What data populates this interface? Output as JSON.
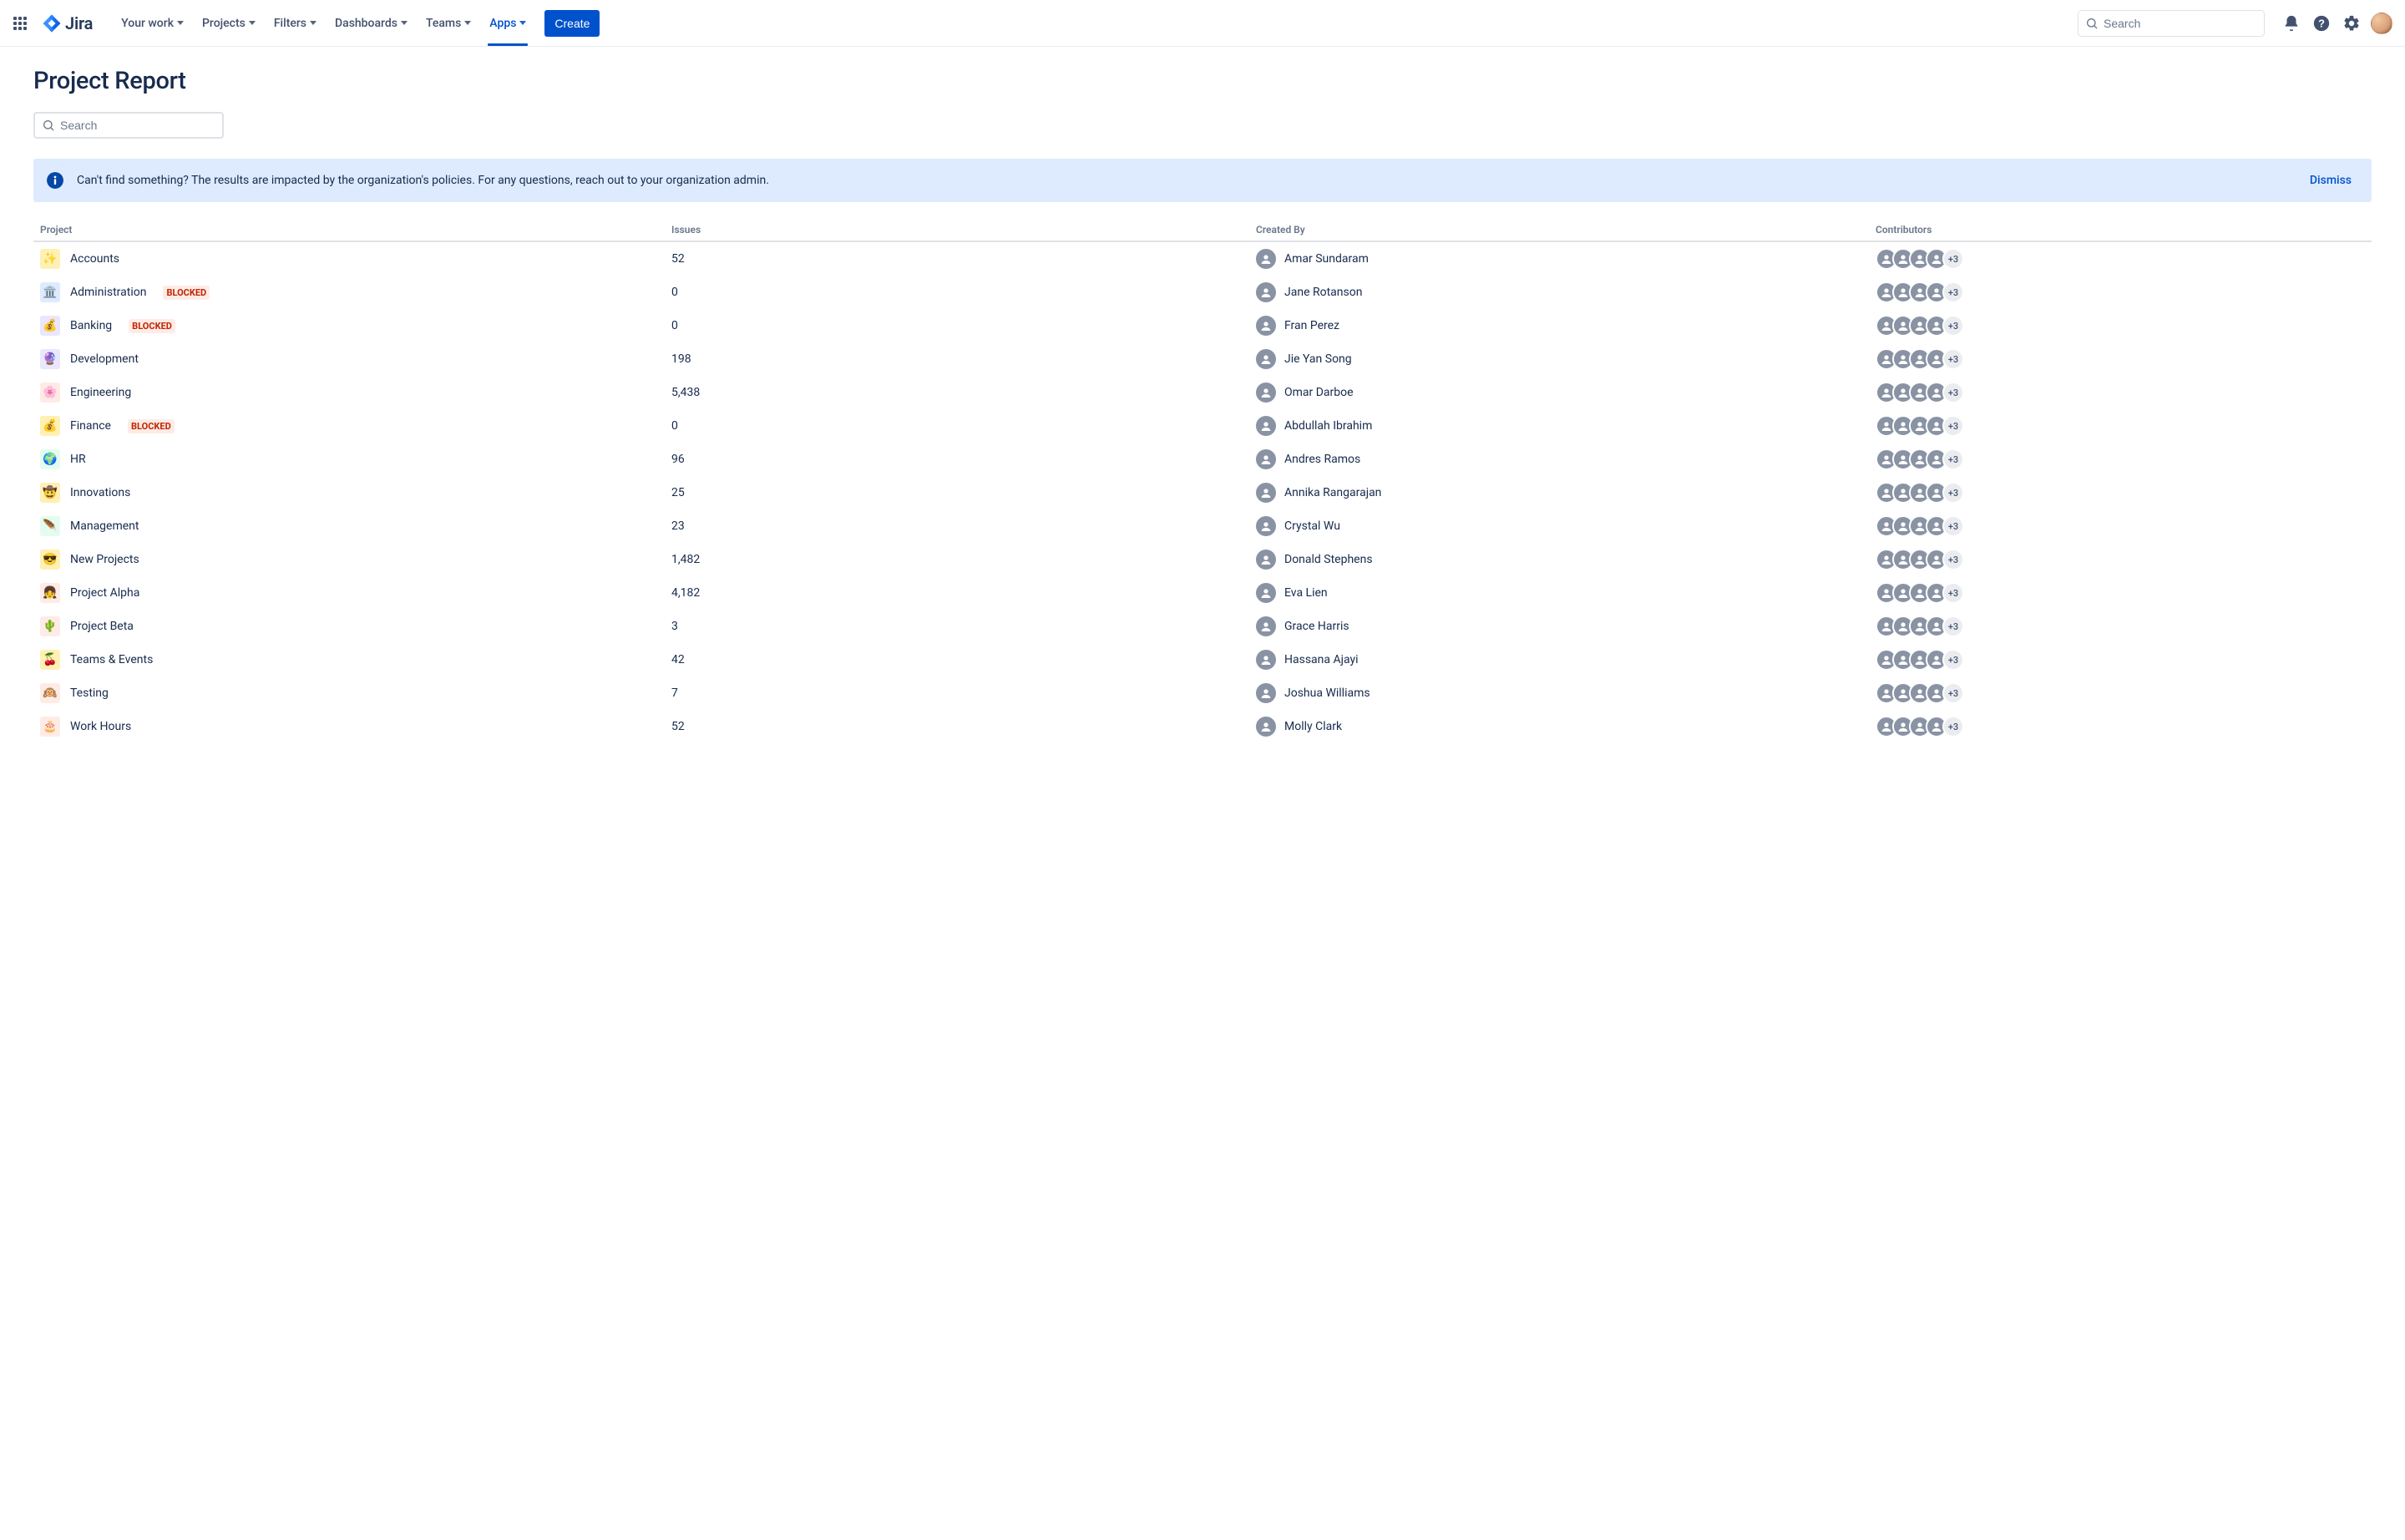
{
  "nav": {
    "logo_text": "Jira",
    "items": [
      {
        "label": "Your work",
        "active": false
      },
      {
        "label": "Projects",
        "active": false
      },
      {
        "label": "Filters",
        "active": false
      },
      {
        "label": "Dashboards",
        "active": false
      },
      {
        "label": "Teams",
        "active": false
      },
      {
        "label": "Apps",
        "active": true
      }
    ],
    "create_label": "Create",
    "search_placeholder": "Search"
  },
  "page": {
    "title": "Project Report",
    "search_placeholder": "Search"
  },
  "banner": {
    "text": "Can't find something? The results are impacted by the organization's policies. For any questions, reach out to your organization admin.",
    "dismiss_label": "Dismiss"
  },
  "table": {
    "columns": {
      "project": "Project",
      "issues": "Issues",
      "created_by": "Created By",
      "contributors": "Contributors"
    },
    "contributors_avatars_shown": 4,
    "rows": [
      {
        "icon": "✨",
        "icon_bg": "#FFF0B3",
        "name": "Accounts",
        "blocked": false,
        "issues": "52",
        "created_by": "Amar Sundaram",
        "more": "+3"
      },
      {
        "icon": "🏛️",
        "icon_bg": "#DEEBFF",
        "name": "Administration",
        "blocked": true,
        "issues": "0",
        "created_by": "Jane Rotanson",
        "more": "+3"
      },
      {
        "icon": "💰",
        "icon_bg": "#EAE6FF",
        "name": "Banking",
        "blocked": true,
        "issues": "0",
        "created_by": "Fran Perez",
        "more": "+3"
      },
      {
        "icon": "🔮",
        "icon_bg": "#EAE6FF",
        "name": "Development",
        "blocked": false,
        "issues": "198",
        "created_by": "Jie Yan Song",
        "more": "+3"
      },
      {
        "icon": "🌸",
        "icon_bg": "#FFEBE6",
        "name": "Engineering",
        "blocked": false,
        "issues": "5,438",
        "created_by": "Omar Darboe",
        "more": "+3"
      },
      {
        "icon": "💰",
        "icon_bg": "#FFF0B3",
        "name": "Finance",
        "blocked": true,
        "issues": "0",
        "created_by": "Abdullah Ibrahim",
        "more": "+3"
      },
      {
        "icon": "🌍",
        "icon_bg": "#E3FCEF",
        "name": "HR",
        "blocked": false,
        "issues": "96",
        "created_by": "Andres Ramos",
        "more": "+3"
      },
      {
        "icon": "🤠",
        "icon_bg": "#FFF0B3",
        "name": "Innovations",
        "blocked": false,
        "issues": "25",
        "created_by": "Annika Rangarajan",
        "more": "+3"
      },
      {
        "icon": "🪶",
        "icon_bg": "#E3FCEF",
        "name": "Management",
        "blocked": false,
        "issues": "23",
        "created_by": "Crystal Wu",
        "more": "+3"
      },
      {
        "icon": "😎",
        "icon_bg": "#FFF0B3",
        "name": "New Projects",
        "blocked": false,
        "issues": "1,482",
        "created_by": "Donald Stephens",
        "more": "+3"
      },
      {
        "icon": "👧",
        "icon_bg": "#FFEBE6",
        "name": "Project Alpha",
        "blocked": false,
        "issues": "4,182",
        "created_by": "Eva Lien",
        "more": "+3"
      },
      {
        "icon": "🌵",
        "icon_bg": "#FFEBE6",
        "name": "Project Beta",
        "blocked": false,
        "issues": "3",
        "created_by": "Grace Harris",
        "more": "+3"
      },
      {
        "icon": "🍒",
        "icon_bg": "#FFF0B3",
        "name": "Teams & Events",
        "blocked": false,
        "issues": "42",
        "created_by": "Hassana Ajayi",
        "more": "+3"
      },
      {
        "icon": "🙉",
        "icon_bg": "#FFEBE6",
        "name": "Testing",
        "blocked": false,
        "issues": "7",
        "created_by": "Joshua Williams",
        "more": "+3"
      },
      {
        "icon": "🎂",
        "icon_bg": "#FFEBE6",
        "name": "Work Hours",
        "blocked": false,
        "issues": "52",
        "created_by": "Molly Clark",
        "more": "+3"
      }
    ],
    "blocked_label": "BLOCKED"
  }
}
